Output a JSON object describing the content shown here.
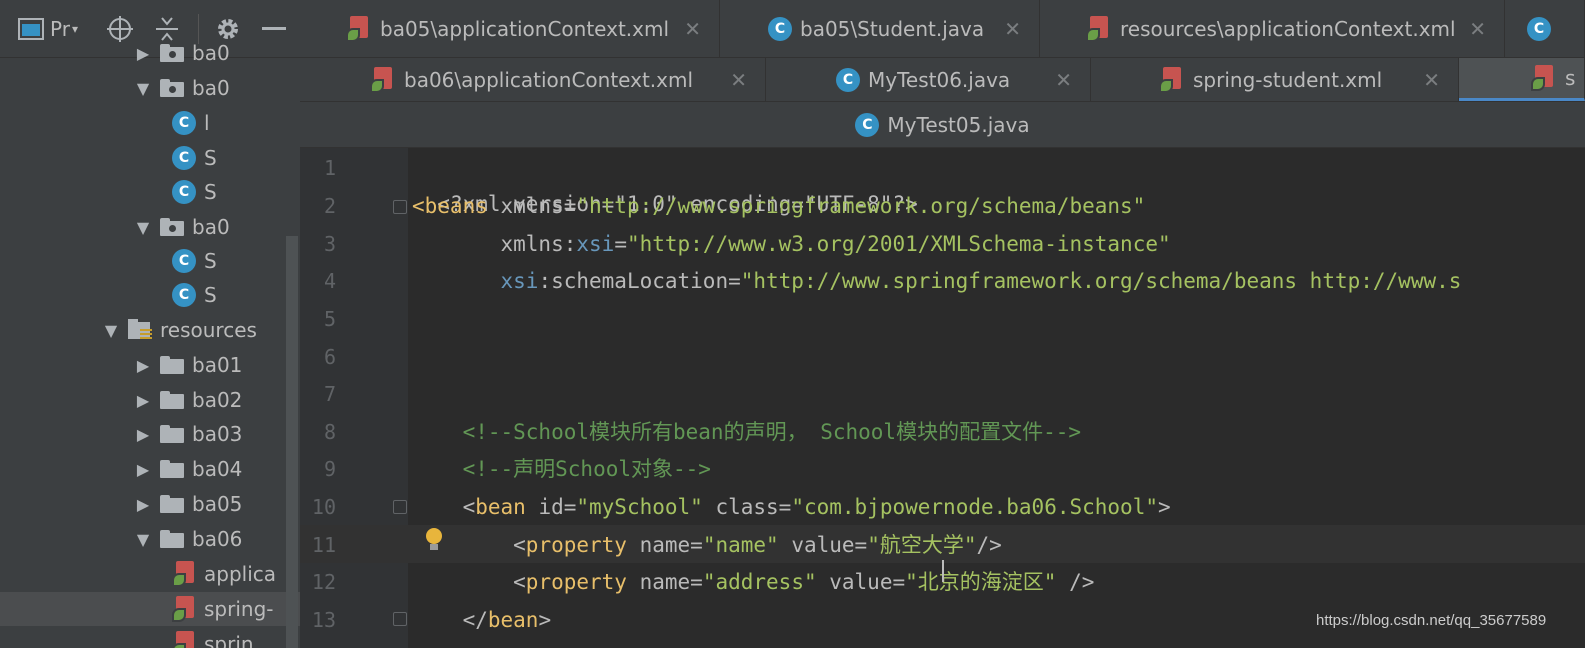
{
  "project": {
    "title": "Pr",
    "toolbar_icons": [
      "window-icon",
      "chevron-down-icon",
      "target-icon",
      "collapse-icon",
      "gear-icon",
      "minimize-icon"
    ],
    "tree": [
      {
        "label": "ba0",
        "type": "package",
        "arrow": "▶",
        "indent": 1
      },
      {
        "label": "ba0",
        "type": "package",
        "arrow": "▼",
        "indent": 1
      },
      {
        "label": "l",
        "type": "class",
        "indent": 2
      },
      {
        "label": "S",
        "type": "class",
        "indent": 2
      },
      {
        "label": "S",
        "type": "class",
        "indent": 2
      },
      {
        "label": "ba0",
        "type": "package",
        "arrow": "▼",
        "indent": 1
      },
      {
        "label": "S",
        "type": "class",
        "indent": 2
      },
      {
        "label": "S",
        "type": "class",
        "indent": 2
      },
      {
        "label": "resources",
        "type": "resources",
        "arrow": "▼",
        "indent": 0
      },
      {
        "label": "ba01",
        "type": "folder",
        "arrow": "▶",
        "indent": 1
      },
      {
        "label": "ba02",
        "type": "folder",
        "arrow": "▶",
        "indent": 1
      },
      {
        "label": "ba03",
        "type": "folder",
        "arrow": "▶",
        "indent": 1
      },
      {
        "label": "ba04",
        "type": "folder",
        "arrow": "▶",
        "indent": 1
      },
      {
        "label": "ba05",
        "type": "folder",
        "arrow": "▶",
        "indent": 1
      },
      {
        "label": "ba06",
        "type": "folder",
        "arrow": "▼",
        "indent": 1
      },
      {
        "label": "applica",
        "type": "xml",
        "indent": 2
      },
      {
        "label": "spring-",
        "type": "xml",
        "indent": 2,
        "selected": true
      },
      {
        "label": "sprin",
        "type": "xml",
        "indent": 2
      }
    ]
  },
  "tabs_row1": [
    {
      "label": "ba05\\applicationContext.xml",
      "icon": "xml"
    },
    {
      "label": "ba05\\Student.java",
      "icon": "class"
    },
    {
      "label": "resources\\applicationContext.xml",
      "icon": "xml"
    },
    {
      "label": "",
      "icon": "class"
    }
  ],
  "tabs_row2": [
    {
      "label": "ba06\\applicationContext.xml",
      "icon": "xml"
    },
    {
      "label": "MyTest06.java",
      "icon": "class"
    },
    {
      "label": "spring-student.xml",
      "icon": "xml"
    },
    {
      "label": "s",
      "icon": "xml",
      "active": true
    }
  ],
  "title_tab": {
    "label": "MyTest05.java"
  },
  "line_numbers": [
    "1",
    "2",
    "3",
    "4",
    "5",
    "6",
    "7",
    "8",
    "9",
    "10",
    "11",
    "12",
    "13"
  ],
  "code": {
    "l1": {
      "a": "<?xml version=\"1.0\" encoding=\"UTF-8\"?>"
    },
    "l2": {
      "tag": "<beans",
      "attr": " xmlns=",
      "val": "\"http://www.springframework.org/schema/beans\""
    },
    "l3": {
      "attr": "       xmlns:",
      "ns": "xsi",
      "eq": "=",
      "val": "\"http://www.w3.org/2001/XMLSchema-instance\""
    },
    "l4": {
      "ns": "       xsi",
      "attr": ":schemaLocation=",
      "val": "\"http://www.springframework.org/schema/beans http://www.s"
    },
    "l8": {
      "comment": "    <!--School模块所有bean的声明， School模块的配置文件-->"
    },
    "l9": {
      "comment": "    <!--声明School对象-->"
    },
    "l10": {
      "lt": "    <",
      "tag": "bean",
      "a1": " id=",
      "v1": "\"mySchool\"",
      "a2": " class=",
      "v2": "\"com.bjpowernode.ba06.School\"",
      "gt": ">"
    },
    "l11": {
      "lt": "        <",
      "tag": "property",
      "a1": " name=",
      "v1": "\"name\"",
      "a2": " value=",
      "v2": "\"航空大学\"",
      "gt": "/>"
    },
    "l12": {
      "lt": "        <",
      "tag": "property",
      "a1": " name=",
      "v1": "\"address\"",
      "a2": " value=",
      "v2": "\"北京的海淀区\"",
      "gt": " />"
    },
    "l13": {
      "lt": "    </",
      "tag": "bean",
      "gt": ">"
    }
  },
  "watermark": "https://blog.csdn.net/qq_35677589",
  "colors": {
    "tag": "#e8bf6a",
    "string": "#a5c261",
    "comment": "#629755",
    "namespace": "#6897bb",
    "bg": "#2b2b2b"
  }
}
